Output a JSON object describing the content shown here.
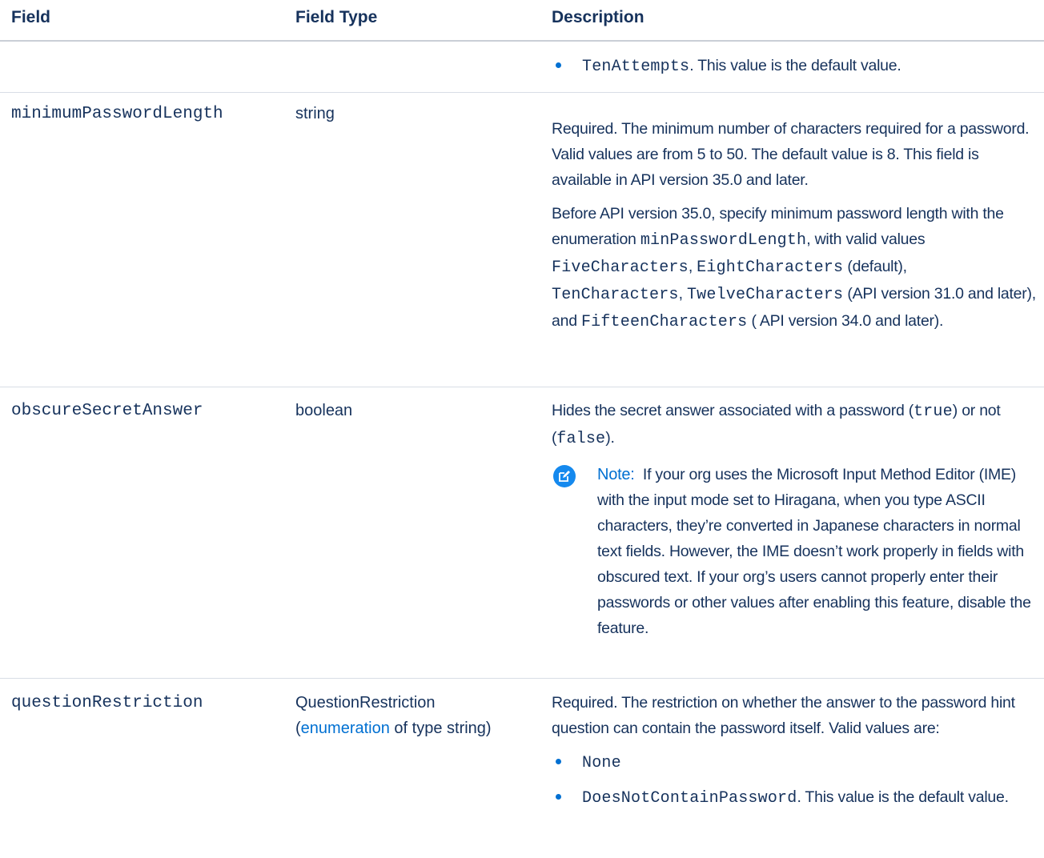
{
  "headers": {
    "field": "Field",
    "field_type": "Field Type",
    "description": "Description"
  },
  "row0": {
    "bullet_code": "TenAttempts",
    "bullet_text": ". This value is the default value."
  },
  "row1": {
    "name": "minimumPasswordLength",
    "type": "string",
    "p1": "Required. The minimum number of characters required for a password. Valid values are from 5 to 50. The default value is 8. This field is available in API version 35.0 and later.",
    "p2_a": "Before API version 35.0, specify minimum password length with the enumeration ",
    "p2_code1": "minPasswordLength",
    "p2_b": ", with valid values ",
    "p2_code2": "FiveCharacters",
    "p2_c": ", ",
    "p2_code3": "EightCharacters",
    "p2_d": " (default), ",
    "p2_code4": "TenCharacters",
    "p2_e": ", ",
    "p2_code5": "TwelveCharacters",
    "p2_f": " (API version 31.0 and later), and ",
    "p2_code6": "FifteenCharacters",
    "p2_g": " ( API version 34.0 and later)."
  },
  "row2": {
    "name": "obscureSecretAnswer",
    "type": "boolean",
    "p1_a": "Hides the secret answer associated with a password (",
    "p1_code1": "true",
    "p1_b": ") or not (",
    "p1_code2": "false",
    "p1_c": ").",
    "note_label": "Note:",
    "note_text": "If your org uses the Microsoft Input Method Editor (IME) with the input mode set to Hiragana, when you type ASCII characters, they’re converted in Japanese characters in normal text fields. However, the IME doesn’t work properly in fields with obscured text. If your org’s users cannot properly enter their passwords or other values after enabling this feature, disable the feature."
  },
  "row3": {
    "name": "questionRestriction",
    "type_line1": "QuestionRestriction",
    "type_paren_open": "(",
    "type_link": "enumeration",
    "type_rest": " of type string)",
    "p1": "Required. The restriction on whether the answer to the password hint question can contain the password itself. Valid values are:",
    "bullet1_code": "None",
    "bullet2_code": "DoesNotContainPassword",
    "bullet2_text": ". This value is the default value."
  },
  "icons": {
    "note": "edit-note-icon"
  },
  "colors": {
    "text": "#16325c",
    "accent": "#0070d2",
    "note_icon": "#1589ee",
    "rule": "#d8dde6"
  }
}
